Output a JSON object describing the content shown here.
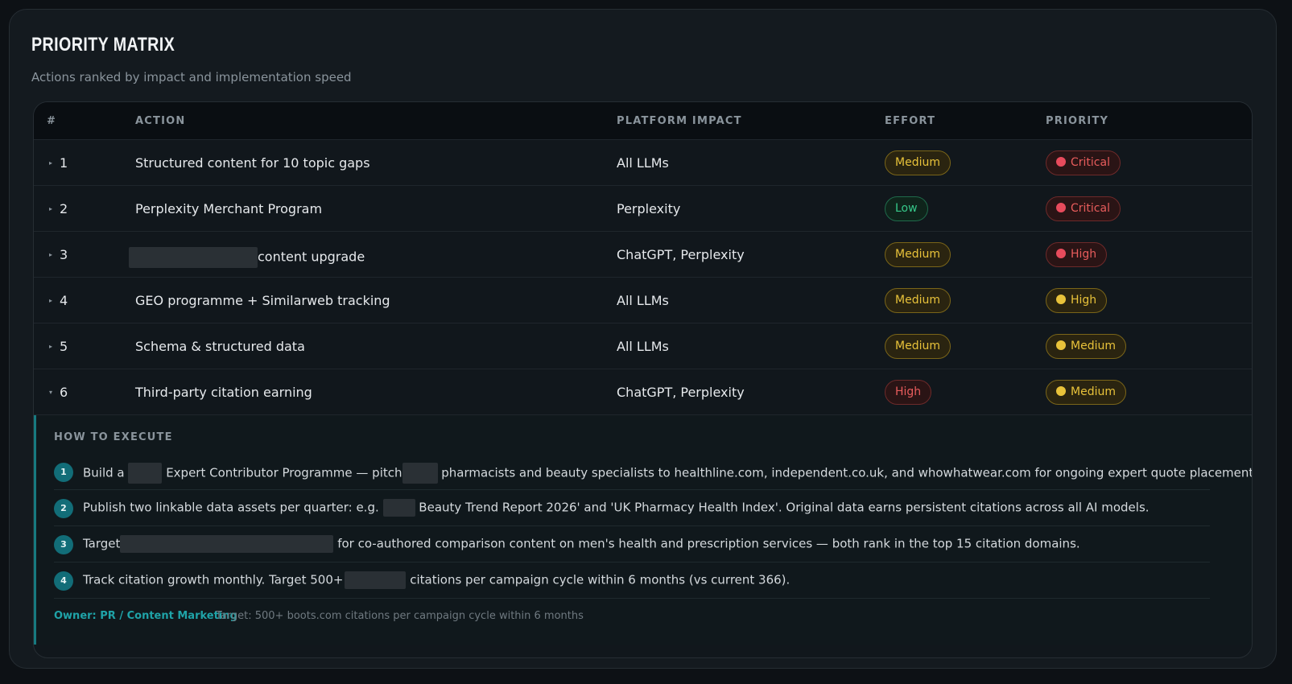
{
  "header": {
    "title": "PRIORITY MATRIX",
    "subtitle": "Actions ranked by impact and implementation speed"
  },
  "columns": {
    "num": "#",
    "action": "ACTION",
    "platform": "PLATFORM IMPACT",
    "effort": "EFFORT",
    "priority": "PRIORITY"
  },
  "rows": [
    {
      "num": "1",
      "action": "Structured content for 10 topic gaps",
      "platform": "All LLMs",
      "effort": "Medium",
      "priority": "Critical"
    },
    {
      "num": "2",
      "action": "Perplexity Merchant Program",
      "platform": "Perplexity",
      "effort": "Low",
      "priority": "Critical"
    },
    {
      "num": "3",
      "action": "content upgrade",
      "platform": "ChatGPT, Perplexity",
      "effort": "Medium",
      "priority": "High"
    },
    {
      "num": "4",
      "action": "GEO programme + Similarweb tracking",
      "platform": "All LLMs",
      "effort": "Medium",
      "priority": "High"
    },
    {
      "num": "5",
      "action": "Schema & structured data",
      "platform": "All LLMs",
      "effort": "Medium",
      "priority": "Medium"
    },
    {
      "num": "6",
      "action": "Third-party citation earning",
      "platform": "ChatGPT, Perplexity",
      "effort": "High",
      "priority": "Medium"
    }
  ],
  "detail": {
    "heading": "HOW TO EXECUTE",
    "steps": [
      {
        "n": "1",
        "a": "Build a",
        "b": "Expert Contributor Programme — pitch",
        "c": "pharmacists and beauty specialists to healthline.com, independent.co.uk, and whowhatwear.com for ongoing expert quote placements."
      },
      {
        "n": "2",
        "a": "Publish two linkable data assets per quarter: e.g.",
        "b": "Beauty Trend Report 2026' and 'UK Pharmacy Health Index'. Original data earns persistent citations across all AI models."
      },
      {
        "n": "3",
        "a": "Target",
        "b": "for co-authored comparison content on men's health and prescription services — both rank in the top 15 citation domains."
      },
      {
        "n": "4",
        "a": "Track citation growth monthly. Target 500+",
        "b": "citations per campaign cycle within 6 months (vs current 366)."
      }
    ],
    "owner": "Owner: PR / Content Marketing",
    "target": "Target: 500+ boots.com citations per campaign cycle within 6 months"
  }
}
